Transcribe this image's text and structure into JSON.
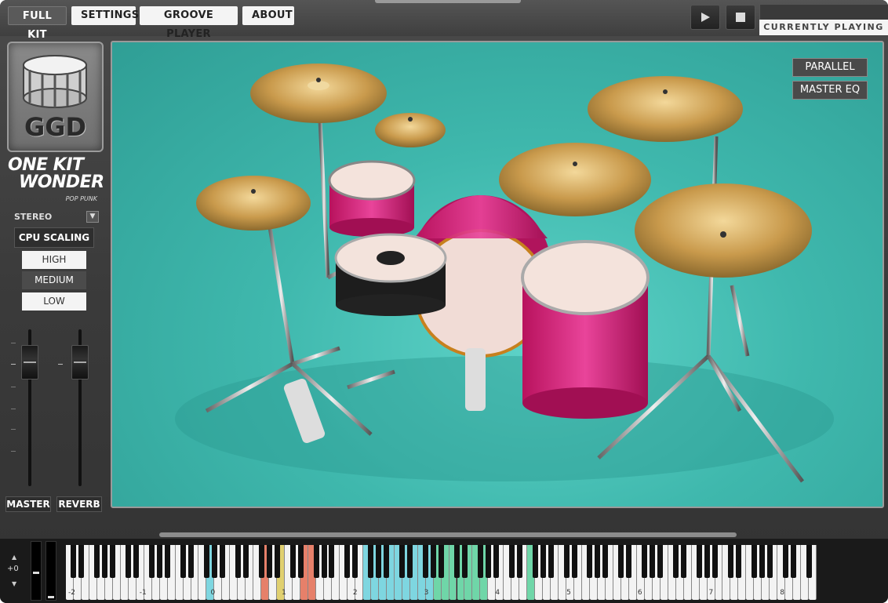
{
  "nav": {
    "tabs": [
      {
        "label": "FULL KIT",
        "active": true
      },
      {
        "label": "SETTINGS",
        "active": false
      },
      {
        "label": "GROOVE PLAYER",
        "active": false
      },
      {
        "label": "ABOUT",
        "active": false
      }
    ]
  },
  "transport": {
    "play_icon": "play-icon",
    "stop_icon": "stop-icon",
    "now_playing_label": "CURRENTLY PLAYING"
  },
  "branding": {
    "logo_text": "GGD",
    "product_line1": "ONE KIT",
    "product_line2": "WONDER",
    "product_sub": "POP PUNK"
  },
  "left_panel": {
    "stereo_label": "STEREO",
    "stereo_toggle_icon": "chevron-down-icon",
    "cpu_scaling_label": "CPU SCALING",
    "quality_options": [
      {
        "label": "HIGH",
        "selected": false
      },
      {
        "label": "MEDIUM",
        "selected": true
      },
      {
        "label": "LOW",
        "selected": false
      }
    ],
    "faders": [
      {
        "label": "MASTER"
      },
      {
        "label": "REVERB"
      }
    ]
  },
  "stage": {
    "parallel_label": "PARALLEL",
    "master_eq_label": "MASTER EQ"
  },
  "keyboard": {
    "octave_shift": "+0",
    "octave_labels": [
      "-2",
      "-1",
      "0",
      "1",
      "2",
      "3",
      "4",
      "5",
      "6",
      "7",
      "8"
    ],
    "key_colors": {
      "cyan": "#7ed6e0",
      "red": "#e6806a",
      "yellow": "#e0d070",
      "green": "#6fd6a8"
    }
  }
}
